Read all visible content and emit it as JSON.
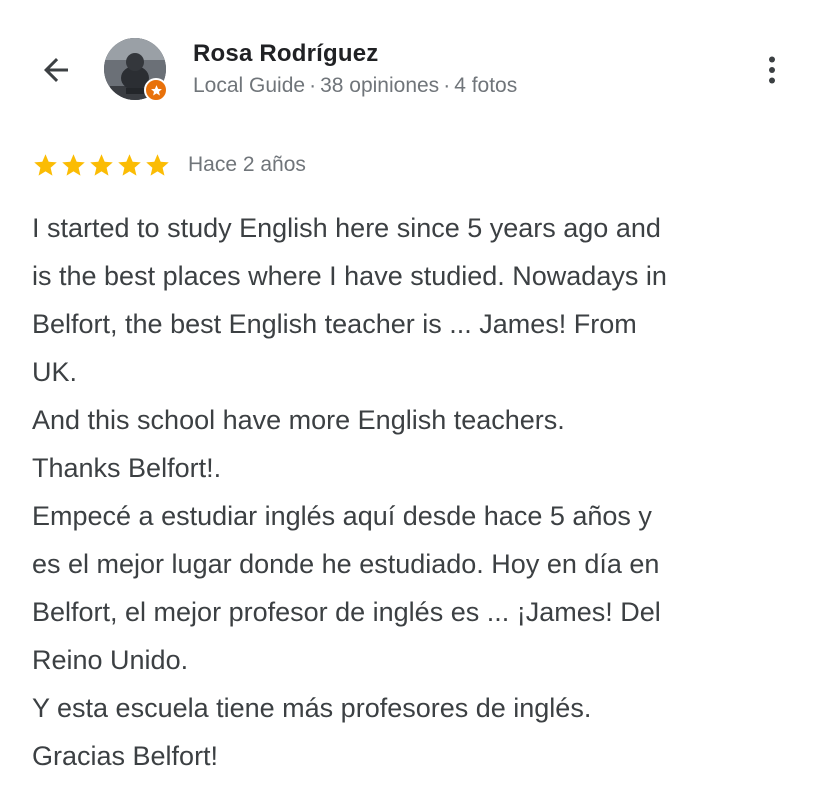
{
  "reviewer": {
    "name": "Rosa Rodríguez",
    "badge": "Local Guide",
    "separator": "·",
    "reviews_count": "38 opiniones",
    "photos_count": "4 fotos"
  },
  "icons": {
    "back": "arrow-left-icon",
    "more": "more-vert-icon",
    "badge": "local-guide-star-icon",
    "star": "star-filled-icon"
  },
  "colors": {
    "star": "#fbbc04",
    "badge": "#e8710a",
    "meta_text": "#70757a",
    "body_text": "#3c4043"
  },
  "review": {
    "rating": 5,
    "rating_max": 5,
    "date": "Hace 2 años",
    "lines": [
      "I started to study English here since 5 years ago and",
      "is the best places where I have studied. Nowadays in",
      "Belfort, the best English teacher is ... James! From",
      "UK.",
      "And this school have more English teachers.",
      "Thanks Belfort!.",
      "Empecé a estudiar inglés aquí desde hace 5 años y",
      "es el mejor lugar donde he estudiado. Hoy en día en",
      "Belfort, el mejor profesor de inglés es ... ¡James! Del",
      "Reino Unido.",
      "Y esta escuela tiene más profesores de inglés.",
      "Gracias Belfort!"
    ]
  }
}
